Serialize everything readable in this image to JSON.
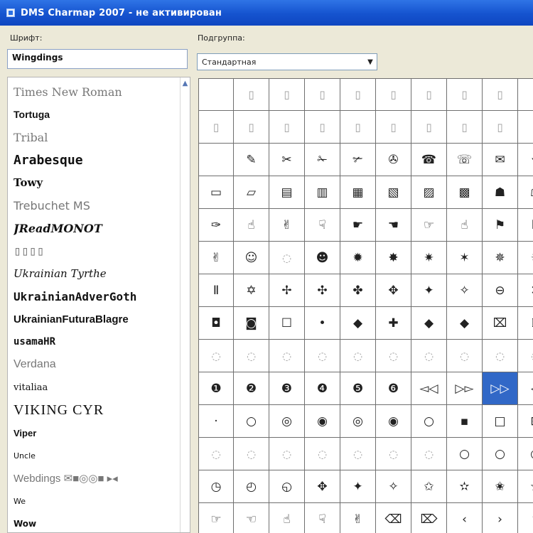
{
  "window": {
    "title": "DMS Charmap 2007 - не активирован"
  },
  "labels": {
    "font": "Шрифт:",
    "subset": "Подгруппа:"
  },
  "font_input": {
    "value": "Wingdings"
  },
  "subset": {
    "value": "Стандартная"
  },
  "font_list": [
    {
      "name": "Times New Roman",
      "color": "#777777"
    },
    {
      "name": "Tortuga",
      "color": "#111111"
    },
    {
      "name": "Tribal",
      "color": "#777777"
    },
    {
      "name": "Arabesque",
      "color": "#111111"
    },
    {
      "name": "Towy",
      "color": "#111111"
    },
    {
      "name": "Trebuchet MS",
      "color": "#777777"
    },
    {
      "name": "JReadMONOT",
      "color": "#111111"
    },
    {
      "name": "▯▯▯▯",
      "color": "#777777"
    },
    {
      "name": "Ukrainian Tyrthe",
      "color": "#111111"
    },
    {
      "name": "UkrainianAdverGoth",
      "color": "#111111"
    },
    {
      "name": "UkrainianFuturaBlagre",
      "color": "#111111"
    },
    {
      "name": "usamaHR",
      "color": "#111111"
    },
    {
      "name": "Verdana",
      "color": "#777777"
    },
    {
      "name": "vitaliaa",
      "color": "#111111"
    },
    {
      "name": "VIKING CYR",
      "color": "#111111"
    },
    {
      "name": "Viper",
      "color": "#111111"
    },
    {
      "name": "Uncle",
      "color": "#111111"
    },
    {
      "name": "Webdings ✉■◎◎■ ▸◂",
      "color": "#777777"
    },
    {
      "name": "We",
      "color": "#111111"
    },
    {
      "name": "Wow",
      "color": "#111111"
    }
  ],
  "char_grid": [
    [
      "",
      "▯",
      "▯",
      "▯",
      "▯",
      "▯",
      "▯",
      "▯",
      "▯",
      "▯"
    ],
    [
      "▯",
      "▯",
      "▯",
      "▯",
      "▯",
      "▯",
      "▯",
      "▯",
      "▯",
      "▯"
    ],
    [
      "",
      "✎",
      "✂",
      "✁",
      "✃",
      "✇",
      "☎",
      "☏",
      "✉",
      "⚘"
    ],
    [
      "▭",
      "▱",
      "▤",
      "▥",
      "▦",
      "▧",
      "▨",
      "▩",
      "☗",
      "☖"
    ],
    [
      "✑",
      "☝",
      "✌",
      "☟",
      "☛",
      "☚",
      "☞",
      "☝",
      "⚑",
      "⚐"
    ],
    [
      "✌",
      "☺",
      "◌",
      "☻",
      "✹",
      "✸",
      "✷",
      "✶",
      "✵",
      "✴"
    ],
    [
      "Ⅱ",
      "✡",
      "✢",
      "✣",
      "✤",
      "✥",
      "✦",
      "✧",
      "⊖",
      "✕"
    ],
    [
      "◘",
      "◙",
      "☐",
      "•",
      "◆",
      "✚",
      "◆",
      "◆",
      "⌧",
      "⍰"
    ],
    [
      "◌",
      "◌",
      "◌",
      "◌",
      "◌",
      "◌",
      "◌",
      "◌",
      "◌",
      "◌"
    ],
    [
      "❶",
      "❷",
      "❸",
      "❹",
      "❺",
      "❻",
      "◅◁",
      "▷▻",
      "▷▷",
      "◁"
    ],
    [
      "·",
      "○",
      "◎",
      "◉",
      "◎",
      "◉",
      "○",
      "▪",
      "□",
      "⊞"
    ],
    [
      "◌",
      "◌",
      "◌",
      "◌",
      "◌",
      "◌",
      "◌",
      "○",
      "○",
      "○"
    ],
    [
      "◷",
      "◴",
      "◵",
      "✥",
      "✦",
      "✧",
      "✩",
      "✫",
      "✬",
      "✭"
    ],
    [
      "☞",
      "☜",
      "☝",
      "☟",
      "✌",
      "⌫",
      "⌦",
      "‹",
      "›",
      "⇧"
    ]
  ],
  "selected_cell": {
    "row": 9,
    "col": 8
  },
  "colors": {
    "title_bar": "#1553cf",
    "selection": "#3168c7",
    "panel_bg": "#ece9d8"
  }
}
